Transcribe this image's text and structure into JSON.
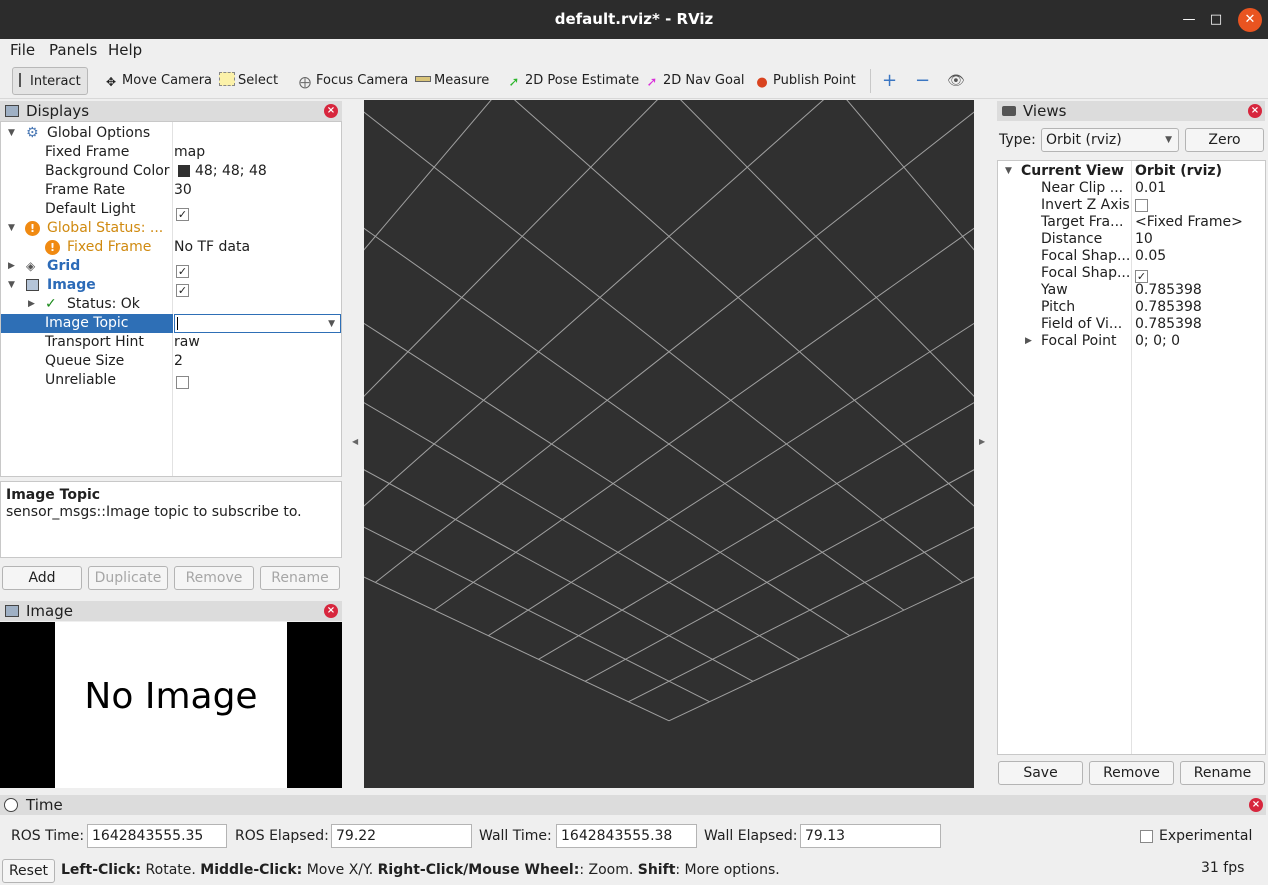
{
  "window": {
    "title": "default.rviz* - RViz"
  },
  "menu": [
    "File",
    "Panels",
    "Help"
  ],
  "toolbar": {
    "tools": [
      "Interact",
      "Move Camera",
      "Select",
      "Focus Camera",
      "Measure",
      "2D Pose Estimate",
      "2D Nav Goal",
      "Publish Point"
    ],
    "active": "Interact"
  },
  "displays": {
    "title": "Displays",
    "rows": [
      {
        "label": "Global Options",
        "value": ""
      },
      {
        "label": "Fixed Frame",
        "value": "map"
      },
      {
        "label": "Background Color",
        "value": "48; 48; 48"
      },
      {
        "label": "Frame Rate",
        "value": "30"
      },
      {
        "label": "Default Light",
        "value": ""
      },
      {
        "label": "Global Status: ...",
        "value": ""
      },
      {
        "label": "Fixed Frame",
        "value": "No TF data"
      },
      {
        "label": "Grid",
        "value": ""
      },
      {
        "label": "Image",
        "value": ""
      },
      {
        "label": "Status: Ok",
        "value": ""
      },
      {
        "label": "Image Topic",
        "value": ""
      },
      {
        "label": "Transport Hint",
        "value": "raw"
      },
      {
        "label": "Queue Size",
        "value": "2"
      },
      {
        "label": "Unreliable",
        "value": ""
      }
    ],
    "description_title": "Image Topic",
    "description_text": "sensor_msgs::Image topic to subscribe to.",
    "buttons": {
      "add": "Add",
      "duplicate": "Duplicate",
      "remove": "Remove",
      "rename": "Rename"
    }
  },
  "image_panel": {
    "title": "Image",
    "no_image": "No Image"
  },
  "views": {
    "title": "Views",
    "type_label": "Type:",
    "type_value": "Orbit (rviz)",
    "zero": "Zero",
    "rows": [
      {
        "label": "Current View",
        "value": "Orbit (rviz)"
      },
      {
        "label": "Near Clip ...",
        "value": "0.01"
      },
      {
        "label": "Invert Z Axis",
        "value": ""
      },
      {
        "label": "Target Fra...",
        "value": "<Fixed Frame>"
      },
      {
        "label": "Distance",
        "value": "10"
      },
      {
        "label": "Focal Shap...",
        "value": "0.05"
      },
      {
        "label": "Focal Shap...",
        "value": ""
      },
      {
        "label": "Yaw",
        "value": "0.785398"
      },
      {
        "label": "Pitch",
        "value": "0.785398"
      },
      {
        "label": "Field of Vi...",
        "value": "0.785398"
      },
      {
        "label": "Focal Point",
        "value": "0; 0; 0"
      }
    ],
    "buttons": {
      "save": "Save",
      "remove": "Remove",
      "rename": "Rename"
    }
  },
  "time": {
    "title": "Time",
    "ros_time_label": "ROS Time:",
    "ros_time": "1642843555.35",
    "ros_elapsed_label": "ROS Elapsed:",
    "ros_elapsed": "79.22",
    "wall_time_label": "Wall Time:",
    "wall_time": "1642843555.38",
    "wall_elapsed_label": "Wall Elapsed:",
    "wall_elapsed": "79.13",
    "experimental": "Experimental"
  },
  "status": {
    "reset": "Reset",
    "hint_left_key": "Left-Click:",
    "hint_left": " Rotate. ",
    "hint_middle_key": "Middle-Click:",
    "hint_middle": " Move X/Y. ",
    "hint_right_key": "Right-Click/Mouse Wheel:",
    "hint_right": ": Zoom. ",
    "hint_shift_key": "Shift",
    "hint_shift": ": More options.",
    "fps": "31 fps"
  },
  "colors": {
    "viewport_bg": "#303030",
    "grid": "#a0a0a0",
    "warning": "#e07a00",
    "link": "#1f5aa6"
  }
}
